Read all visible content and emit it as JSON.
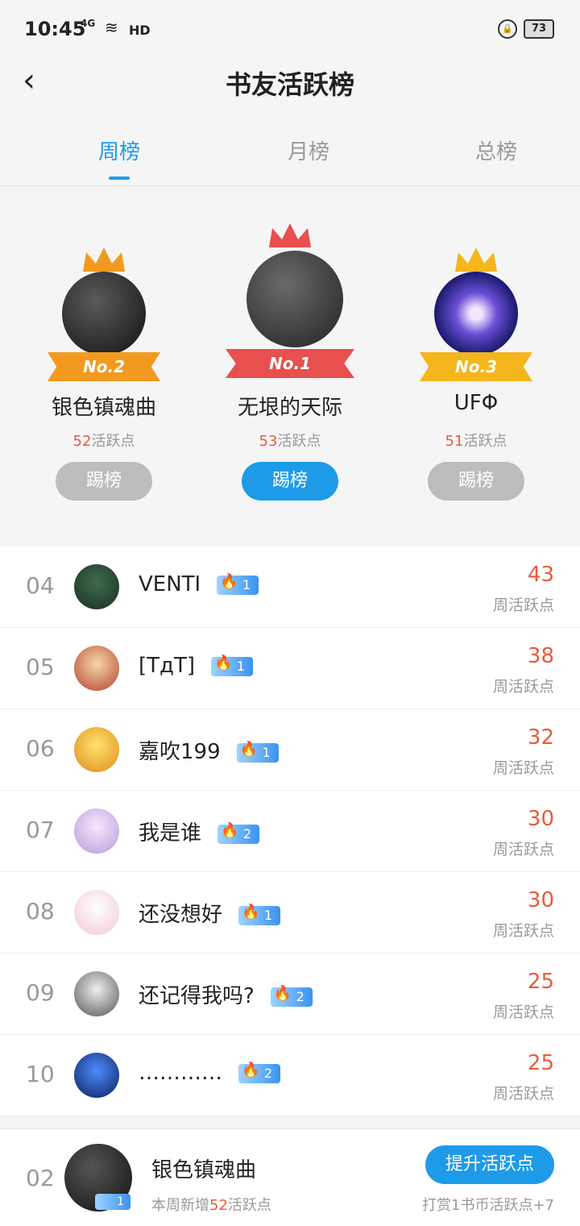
{
  "status": {
    "time": "10:45",
    "network": "4G",
    "hd": "HD",
    "battery": "73"
  },
  "header": {
    "back_icon": "chevron-left-icon",
    "title": "书友活跃榜"
  },
  "tabs": [
    {
      "label": "周榜",
      "active": true
    },
    {
      "label": "月榜",
      "active": false
    },
    {
      "label": "总榜",
      "active": false
    }
  ],
  "podium": [
    {
      "rank_label": "No.2",
      "name": "银色镇魂曲",
      "points": "52",
      "points_suffix": "活跃点",
      "button": "踢榜"
    },
    {
      "rank_label": "No.1",
      "name": "无垠的天际",
      "points": "53",
      "points_suffix": "活跃点",
      "button": "踢榜"
    },
    {
      "rank_label": "No.3",
      "name": "UFΦ",
      "points": "51",
      "points_suffix": "活跃点",
      "button": "踢榜"
    }
  ],
  "list": [
    {
      "rank": "04",
      "name": "VENTI",
      "level": "1",
      "score": "43",
      "score_label": "周活跃点"
    },
    {
      "rank": "05",
      "name": "[TдT]",
      "level": "1",
      "score": "38",
      "score_label": "周活跃点"
    },
    {
      "rank": "06",
      "name": "嘉吹199",
      "level": "1",
      "score": "32",
      "score_label": "周活跃点"
    },
    {
      "rank": "07",
      "name": "我是谁",
      "level": "2",
      "score": "30",
      "score_label": "周活跃点"
    },
    {
      "rank": "08",
      "name": "还没想好",
      "level": "1",
      "score": "30",
      "score_label": "周活跃点"
    },
    {
      "rank": "09",
      "name": "还记得我吗?",
      "level": "2",
      "score": "25",
      "score_label": "周活跃点"
    },
    {
      "rank": "10",
      "name": "…………",
      "level": "2",
      "score": "25",
      "score_label": "周活跃点"
    }
  ],
  "footer": {
    "rank": "02",
    "name": "银色镇魂曲",
    "level": "1",
    "sub_prefix": "本周新增",
    "sub_points": "52",
    "sub_suffix": "活跃点",
    "button": "提升活跃点",
    "tip": "打赏1书币活跃点+7"
  },
  "colors": {
    "accent": "#1e9be8",
    "score": "#ea5a3e",
    "no1": "#e84f4f",
    "no2": "#f29a1f",
    "no3": "#f5b51c"
  }
}
